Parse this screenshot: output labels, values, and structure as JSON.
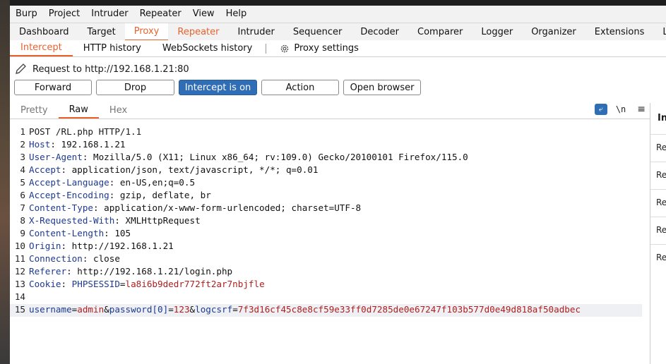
{
  "menu": [
    "Burp",
    "Project",
    "Intruder",
    "Repeater",
    "View",
    "Help"
  ],
  "main_tabs": [
    "Dashboard",
    "Target",
    "Proxy",
    "Repeater",
    "Intruder",
    "Sequencer",
    "Decoder",
    "Comparer",
    "Logger",
    "Organizer",
    "Extensions",
    "L"
  ],
  "sub_tabs": [
    "Intercept",
    "HTTP history",
    "WebSockets history"
  ],
  "proxy_settings": "Proxy settings",
  "request_to": "Request to http://192.168.1.21:80",
  "buttons": {
    "forward": "Forward",
    "drop": "Drop",
    "intercept": "Intercept is on",
    "action": "Action",
    "open_browser": "Open browser"
  },
  "editor_tabs": [
    "Pretty",
    "Raw",
    "Hex"
  ],
  "editor_icons": {
    "wrap": "wrap-icon",
    "newline": "\\n",
    "menu": "≡"
  },
  "request_line": "POST /RL.php HTTP/1.1",
  "headers": [
    {
      "k": "Host",
      "v": "192.168.1.21"
    },
    {
      "k": "User-Agent",
      "v": "Mozilla/5.0 (X11; Linux x86_64; rv:109.0) Gecko/20100101 Firefox/115.0"
    },
    {
      "k": "Accept",
      "v": "application/json, text/javascript, */*; q=0.01"
    },
    {
      "k": "Accept-Language",
      "v": "en-US,en;q=0.5"
    },
    {
      "k": "Accept-Encoding",
      "v": "gzip, deflate, br"
    },
    {
      "k": "Content-Type",
      "v": "application/x-www-form-urlencoded; charset=UTF-8"
    },
    {
      "k": "X-Requested-With",
      "v": "XMLHttpRequest"
    },
    {
      "k": "Content-Length",
      "v": "105"
    },
    {
      "k": "Origin",
      "v": "http://192.168.1.21"
    },
    {
      "k": "Connection",
      "v": "close"
    },
    {
      "k": "Referer",
      "v": "http://192.168.1.21/login.php"
    }
  ],
  "cookie": {
    "k": "Cookie",
    "name": "PHPSESSID",
    "value": "la8i6b9dedr772ft2ar7nbjfle"
  },
  "body_params": [
    {
      "k": "username",
      "v": "admin"
    },
    {
      "k": "password[0]",
      "v": "123"
    },
    {
      "k": "logcsrf",
      "v": "7f3d16cf45c8e8cf59e33ff0d7285de0e67247f103b577d0e49d818af50adbec"
    }
  ],
  "line_numbers": [
    "1",
    "2",
    "3",
    "4",
    "5",
    "6",
    "7",
    "8",
    "9",
    "10",
    "11",
    "12",
    "13",
    "14",
    "15"
  ],
  "inspector": {
    "title": "In",
    "rows": [
      "Re",
      "Re",
      "Re",
      "Re",
      "Re"
    ]
  },
  "colors": {
    "accent": "#e8632b",
    "blue": "#2f6db5",
    "key": "#1d3a8f",
    "value": "#b01e1e"
  }
}
